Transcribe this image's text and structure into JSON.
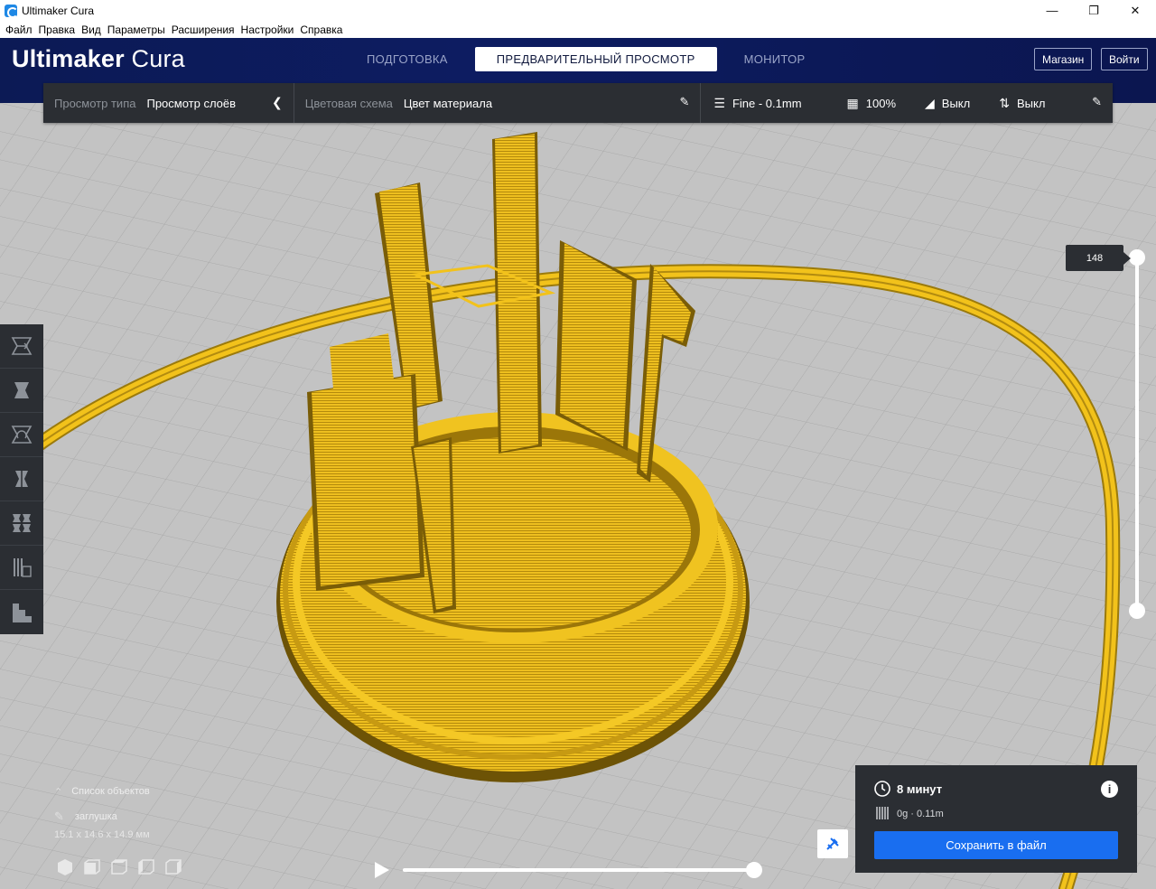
{
  "window": {
    "title": "Ultimaker Cura"
  },
  "menu": [
    "Файл",
    "Правка",
    "Вид",
    "Параметры",
    "Расширения",
    "Настройки",
    "Справка"
  ],
  "brand": {
    "bold": "Ultimaker",
    "light": " Cura"
  },
  "stages": [
    {
      "label": "ПОДГОТОВКА",
      "active": false
    },
    {
      "label": "ПРЕДВАРИТЕЛЬНЫЙ ПРОСМОТР",
      "active": true
    },
    {
      "label": "МОНИТОР",
      "active": false
    }
  ],
  "header_buttons": {
    "marketplace": "Магазин",
    "signin": "Войти"
  },
  "viewbar": {
    "view_type_label": "Просмотр типа",
    "view_type_value": "Просмотр слоёв",
    "color_scheme_label": "Цветовая схема",
    "color_scheme_value": "Цвет материала",
    "profile": "Fine - 0.1mm",
    "infill": "100%",
    "support": "Выкл",
    "adhesion": "Выкл"
  },
  "layer_slider": {
    "current": "148"
  },
  "objects": {
    "header": "Список объектов",
    "name": "заглушка",
    "dimensions": "15.1 x 14.6 x 14.9 мм"
  },
  "output": {
    "time": "8 минут",
    "material": "0g · 0.11m",
    "save_label": "Сохранить в файл"
  },
  "colors": {
    "accent": "#196ef0",
    "header": "#0c1a55",
    "panel": "#2b2e33",
    "filament": "#f2c21b"
  }
}
